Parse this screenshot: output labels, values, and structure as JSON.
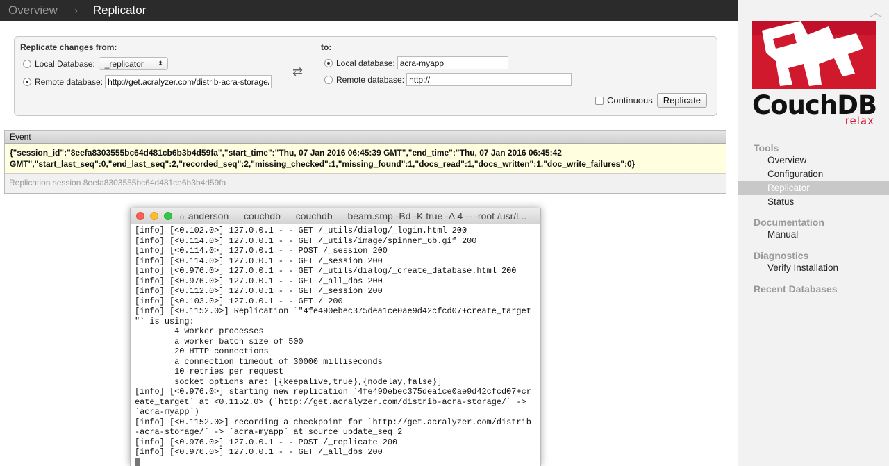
{
  "breadcrumb": {
    "parent": "Overview",
    "current": "Replicator",
    "separator": "›"
  },
  "form": {
    "from_label": "Replicate changes from:",
    "to_label": "to:",
    "local_db_label": "Local Database:",
    "local_db_value": "_replicator",
    "remote_db_label": "Remote database:",
    "remote_db_value": "http://get.acralyzer.com/distrib-acra-storage/",
    "to_local_label": "Local database:",
    "to_local_value": "acra-myapp",
    "to_remote_label": "Remote database:",
    "to_remote_value": "http://",
    "continuous_label": "Continuous",
    "replicate_button": "Replicate",
    "swap_icon": "⇄"
  },
  "event": {
    "header": "Event",
    "line1": "{\"session_id\":\"8eefa8303555bc64d481cb6b3b4d59fa\",\"start_time\":\"Thu, 07 Jan 2016 06:45:39 GMT\",\"end_time\":\"Thu, 07 Jan 2016 06:45:42",
    "line2": "GMT\",\"start_last_seq\":0,\"end_last_seq\":2,\"recorded_seq\":2,\"missing_checked\":1,\"missing_found\":1,\"docs_read\":1,\"docs_written\":1,\"doc_write_failures\":0}",
    "footer": "Replication session 8eefa8303555bc64d481cb6b3b4d59fa"
  },
  "terminal": {
    "title": "anderson — couchdb — couchdb — beam.smp -Bd -K true -A 4 -- -root /usr/l...",
    "lines": [
      "[info] [<0.102.0>] 127.0.0.1 - - GET /_utils/dialog/_login.html 200",
      "[info] [<0.114.0>] 127.0.0.1 - - GET /_utils/image/spinner_6b.gif 200",
      "[info] [<0.114.0>] 127.0.0.1 - - POST /_session 200",
      "[info] [<0.114.0>] 127.0.0.1 - - GET /_session 200",
      "[info] [<0.976.0>] 127.0.0.1 - - GET /_utils/dialog/_create_database.html 200",
      "[info] [<0.976.0>] 127.0.0.1 - - GET /_all_dbs 200",
      "[info] [<0.112.0>] 127.0.0.1 - - GET /_session 200",
      "[info] [<0.103.0>] 127.0.0.1 - - GET / 200",
      "[info] [<0.1152.0>] Replication `\"4fe490ebec375dea1ce0ae9d42cfcd07+create_target",
      "\"` is using:",
      "        4 worker processes",
      "        a worker batch size of 500",
      "        20 HTTP connections",
      "        a connection timeout of 30000 milliseconds",
      "        10 retries per request",
      "        socket options are: [{keepalive,true},{nodelay,false}]",
      "[info] [<0.976.0>] starting new replication `4fe490ebec375dea1ce0ae9d42cfcd07+cr",
      "eate_target` at <0.1152.0> (`http://get.acralyzer.com/distrib-acra-storage/` ->",
      "`acra-myapp`)",
      "[info] [<0.1152.0>] recording a checkpoint for `http://get.acralyzer.com/distrib",
      "-acra-storage/` -> `acra-myapp` at source update_seq 2",
      "[info] [<0.976.0>] 127.0.0.1 - - POST /_replicate 200",
      "[info] [<0.976.0>] 127.0.0.1 - - GET /_all_dbs 200"
    ]
  },
  "sidebar": {
    "logo_text": "CouchDB",
    "logo_tagline": "relax",
    "sections": {
      "tools": "Tools",
      "documentation": "Documentation",
      "diagnostics": "Diagnostics",
      "recent": "Recent Databases"
    },
    "tools_items": [
      "Overview",
      "Configuration",
      "Replicator",
      "Status"
    ],
    "documentation_items": [
      "Manual"
    ],
    "diagnostics_items": [
      "Verify Installation"
    ]
  },
  "colors": {
    "brand_red": "#d1192e",
    "active_nav": "#c8c8c8",
    "event_bg": "#ffffe0"
  }
}
